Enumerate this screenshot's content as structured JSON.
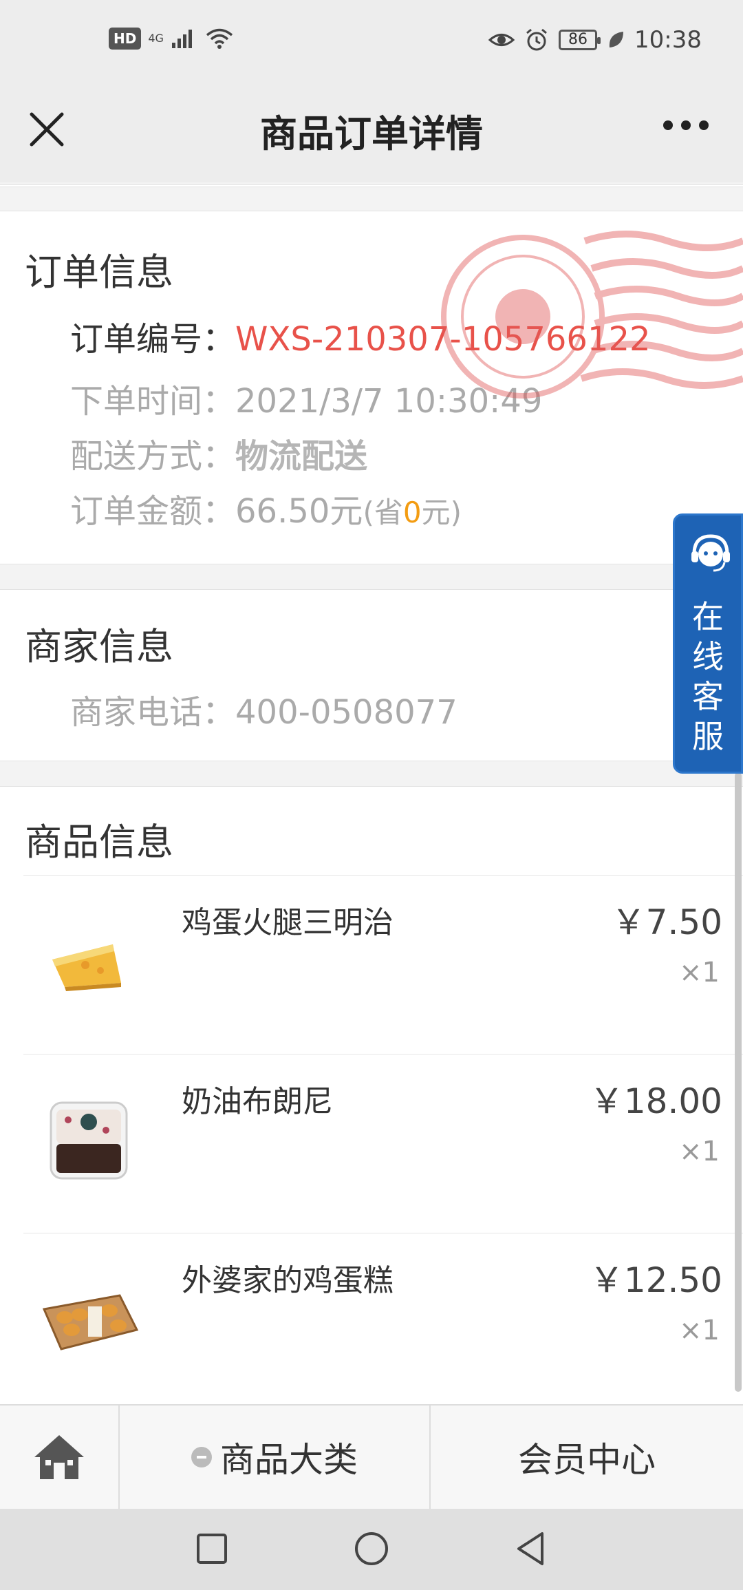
{
  "status_bar": {
    "hd": "HD",
    "network": "4G",
    "battery": "86",
    "time": "10:38"
  },
  "header": {
    "title": "商品订单详情"
  },
  "order_info": {
    "title": "订单信息",
    "order_no_label": "订单编号：",
    "order_no": "WXS-210307-105766122",
    "time_label": "下单时间：",
    "time": "2021/3/7 10:30:49",
    "delivery_label": "配送方式：",
    "delivery": "物流配送",
    "amount_label": "订单金额：",
    "amount": "66.50元",
    "saved_prefix": "(省",
    "saved_value": "0",
    "saved_suffix": "元)"
  },
  "merchant_info": {
    "title": "商家信息",
    "phone_label": "商家电话：",
    "phone": "400-0508077"
  },
  "customer_service": {
    "chars": [
      "在",
      "线",
      "客",
      "服"
    ]
  },
  "products": {
    "title": "商品信息",
    "items": [
      {
        "name": "鸡蛋火腿三明治",
        "price": "￥7.50",
        "qty": "×1"
      },
      {
        "name": "奶油布朗尼",
        "price": "￥18.00",
        "qty": "×1"
      },
      {
        "name": "外婆家的鸡蛋糕",
        "price": "￥12.50",
        "qty": "×1"
      }
    ]
  },
  "tabbar": {
    "category": "商品大类",
    "member": "会员中心"
  },
  "colors": {
    "accent_red": "#e8524a",
    "saved_orange": "#f39c12",
    "cs_blue": "#1e63b5"
  }
}
